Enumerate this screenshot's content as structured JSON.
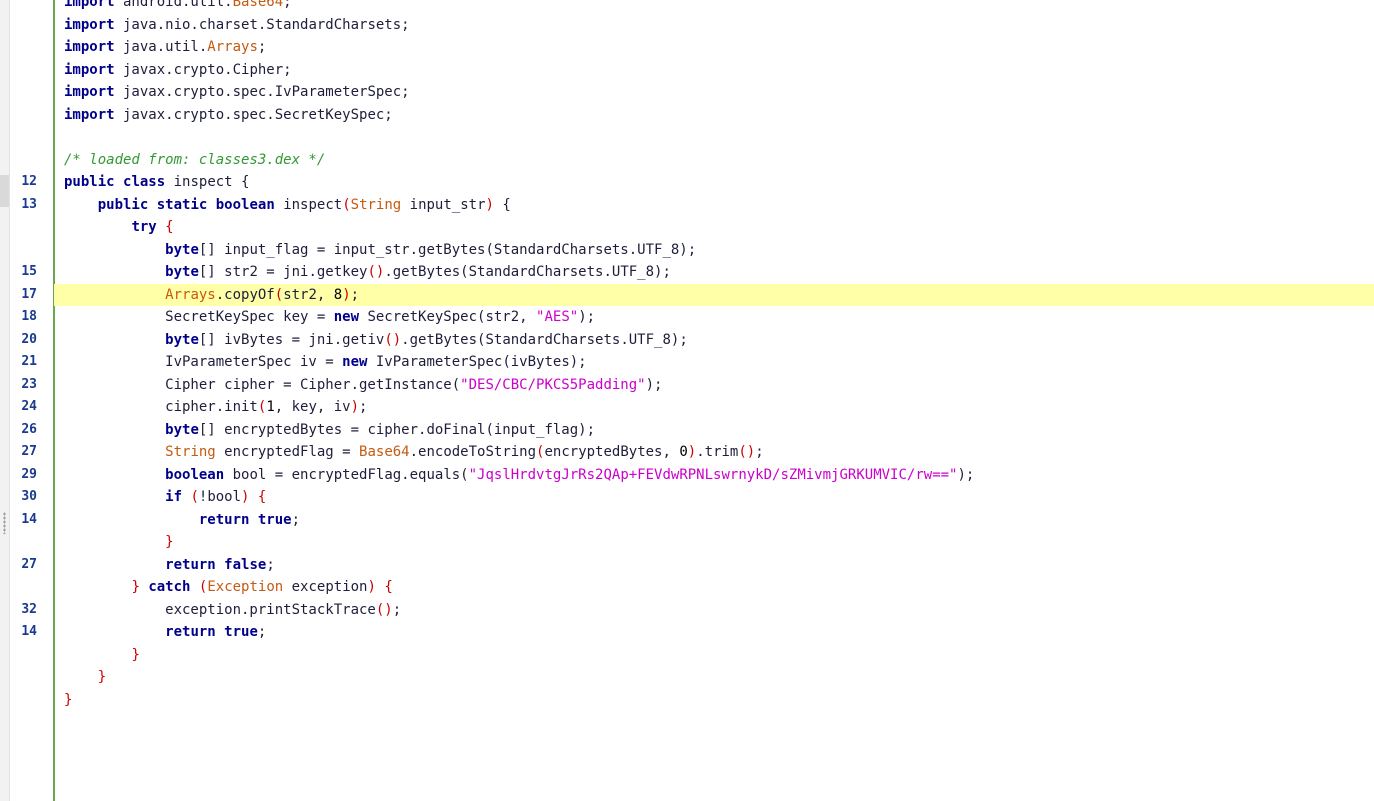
{
  "editor": {
    "lines": [
      {
        "ln": "",
        "tokens": [
          {
            "t": "import",
            "k": "kw"
          },
          {
            "t": " android.util.",
            "k": "plain"
          },
          {
            "t": "Base64",
            "k": "type"
          },
          {
            "t": ";",
            "k": "plain"
          }
        ]
      },
      {
        "ln": "",
        "tokens": [
          {
            "t": "import",
            "k": "kw"
          },
          {
            "t": " java.nio.charset.StandardCharsets;",
            "k": "plain"
          }
        ]
      },
      {
        "ln": "",
        "tokens": [
          {
            "t": "import",
            "k": "kw"
          },
          {
            "t": " java.util.",
            "k": "plain"
          },
          {
            "t": "Arrays",
            "k": "type"
          },
          {
            "t": ";",
            "k": "plain"
          }
        ]
      },
      {
        "ln": "",
        "tokens": [
          {
            "t": "import",
            "k": "kw"
          },
          {
            "t": " javax.crypto.Cipher;",
            "k": "plain"
          }
        ]
      },
      {
        "ln": "",
        "tokens": [
          {
            "t": "import",
            "k": "kw"
          },
          {
            "t": " javax.crypto.spec.IvParameterSpec;",
            "k": "plain"
          }
        ]
      },
      {
        "ln": "",
        "tokens": [
          {
            "t": "import",
            "k": "kw"
          },
          {
            "t": " javax.crypto.spec.SecretKeySpec;",
            "k": "plain"
          }
        ]
      },
      {
        "ln": "",
        "tokens": []
      },
      {
        "ln": "",
        "tokens": [
          {
            "t": "/* loaded from: classes3.dex */",
            "k": "cmt"
          }
        ]
      },
      {
        "ln": "12",
        "tokens": [
          {
            "t": "public",
            "k": "kw"
          },
          {
            "t": " ",
            "k": "plain"
          },
          {
            "t": "class",
            "k": "kw"
          },
          {
            "t": " inspect ",
            "k": "plain"
          },
          {
            "t": "{",
            "k": "plain"
          }
        ]
      },
      {
        "ln": "13",
        "tokens": [
          {
            "t": "    ",
            "k": "plain"
          },
          {
            "t": "public",
            "k": "kw"
          },
          {
            "t": " ",
            "k": "plain"
          },
          {
            "t": "static",
            "k": "kw"
          },
          {
            "t": " ",
            "k": "plain"
          },
          {
            "t": "boolean",
            "k": "kw"
          },
          {
            "t": " inspect",
            "k": "plain"
          },
          {
            "t": "(",
            "k": "punc"
          },
          {
            "t": "String",
            "k": "type"
          },
          {
            "t": " input_str",
            "k": "plain"
          },
          {
            "t": ")",
            "k": "punc"
          },
          {
            "t": " {",
            "k": "plain"
          }
        ]
      },
      {
        "ln": "",
        "tokens": [
          {
            "t": "        ",
            "k": "plain"
          },
          {
            "t": "try",
            "k": "kw"
          },
          {
            "t": " ",
            "k": "plain"
          },
          {
            "t": "{",
            "k": "punc"
          }
        ]
      },
      {
        "ln": "",
        "tokens": [
          {
            "t": "            ",
            "k": "plain"
          },
          {
            "t": "byte",
            "k": "kw"
          },
          {
            "t": "[] input_flag = input_str.getBytes(StandardCharsets.UTF_8);",
            "k": "plain"
          }
        ]
      },
      {
        "ln": "15",
        "tokens": [
          {
            "t": "            ",
            "k": "plain"
          },
          {
            "t": "byte",
            "k": "kw"
          },
          {
            "t": "[] str2 = jni.getkey",
            "k": "plain"
          },
          {
            "t": "()",
            "k": "punc"
          },
          {
            "t": ".getBytes(StandardCharsets.UTF_8);",
            "k": "plain"
          }
        ]
      },
      {
        "ln": "17",
        "hl": true,
        "tokens": [
          {
            "t": "            ",
            "k": "plain"
          },
          {
            "t": "Arrays",
            "k": "type"
          },
          {
            "t": ".copyOf",
            "k": "plain"
          },
          {
            "t": "(",
            "k": "punc"
          },
          {
            "t": "str2, ",
            "k": "plain"
          },
          {
            "t": "8",
            "k": "num"
          },
          {
            "t": ")",
            "k": "punc"
          },
          {
            "t": ";",
            "k": "plain"
          }
        ]
      },
      {
        "ln": "18",
        "tokens": [
          {
            "t": "            SecretKeySpec key = ",
            "k": "plain"
          },
          {
            "t": "new",
            "k": "kw"
          },
          {
            "t": " SecretKeySpec(str2, ",
            "k": "plain"
          },
          {
            "t": "\"AES\"",
            "k": "str"
          },
          {
            "t": ");",
            "k": "plain"
          }
        ]
      },
      {
        "ln": "20",
        "tokens": [
          {
            "t": "            ",
            "k": "plain"
          },
          {
            "t": "byte",
            "k": "kw"
          },
          {
            "t": "[] ivBytes = jni.getiv",
            "k": "plain"
          },
          {
            "t": "()",
            "k": "punc"
          },
          {
            "t": ".getBytes(StandardCharsets.UTF_8);",
            "k": "plain"
          }
        ]
      },
      {
        "ln": "21",
        "tokens": [
          {
            "t": "            IvParameterSpec iv = ",
            "k": "plain"
          },
          {
            "t": "new",
            "k": "kw"
          },
          {
            "t": " IvParameterSpec(ivBytes);",
            "k": "plain"
          }
        ]
      },
      {
        "ln": "23",
        "tokens": [
          {
            "t": "            Cipher cipher = Cipher.getInstance(",
            "k": "plain"
          },
          {
            "t": "\"DES/CBC/PKCS5Padding\"",
            "k": "str"
          },
          {
            "t": ");",
            "k": "plain"
          }
        ]
      },
      {
        "ln": "24",
        "tokens": [
          {
            "t": "            cipher.init",
            "k": "plain"
          },
          {
            "t": "(",
            "k": "punc"
          },
          {
            "t": "1",
            "k": "num"
          },
          {
            "t": ", key, iv",
            "k": "plain"
          },
          {
            "t": ")",
            "k": "punc"
          },
          {
            "t": ";",
            "k": "plain"
          }
        ]
      },
      {
        "ln": "26",
        "tokens": [
          {
            "t": "            ",
            "k": "plain"
          },
          {
            "t": "byte",
            "k": "kw"
          },
          {
            "t": "[] encryptedBytes = cipher.doFinal(input_flag);",
            "k": "plain"
          }
        ]
      },
      {
        "ln": "27",
        "tokens": [
          {
            "t": "            ",
            "k": "plain"
          },
          {
            "t": "String",
            "k": "type"
          },
          {
            "t": " encryptedFlag = ",
            "k": "plain"
          },
          {
            "t": "Base64",
            "k": "type"
          },
          {
            "t": ".encodeToString",
            "k": "plain"
          },
          {
            "t": "(",
            "k": "punc"
          },
          {
            "t": "encryptedBytes, ",
            "k": "plain"
          },
          {
            "t": "0",
            "k": "num"
          },
          {
            "t": ")",
            "k": "punc"
          },
          {
            "t": ".trim",
            "k": "plain"
          },
          {
            "t": "()",
            "k": "punc"
          },
          {
            "t": ";",
            "k": "plain"
          }
        ]
      },
      {
        "ln": "29",
        "tokens": [
          {
            "t": "            ",
            "k": "plain"
          },
          {
            "t": "boolean",
            "k": "kw"
          },
          {
            "t": " bool = encryptedFlag.equals(",
            "k": "plain"
          },
          {
            "t": "\"JqslHrdvtgJrRs2QAp+FEVdwRPNLswrnykD/sZMivmjGRKUMVIC/rw==\"",
            "k": "str"
          },
          {
            "t": ");",
            "k": "plain"
          }
        ]
      },
      {
        "ln": "30",
        "tokens": [
          {
            "t": "            ",
            "k": "plain"
          },
          {
            "t": "if",
            "k": "kw"
          },
          {
            "t": " ",
            "k": "plain"
          },
          {
            "t": "(",
            "k": "punc"
          },
          {
            "t": "!bool",
            "k": "plain"
          },
          {
            "t": ")",
            "k": "punc"
          },
          {
            "t": " ",
            "k": "plain"
          },
          {
            "t": "{",
            "k": "punc"
          }
        ]
      },
      {
        "ln": "14",
        "tokens": [
          {
            "t": "                ",
            "k": "plain"
          },
          {
            "t": "return",
            "k": "kw"
          },
          {
            "t": " ",
            "k": "plain"
          },
          {
            "t": "true",
            "k": "kw"
          },
          {
            "t": ";",
            "k": "plain"
          }
        ]
      },
      {
        "ln": "",
        "tokens": [
          {
            "t": "            ",
            "k": "plain"
          },
          {
            "t": "}",
            "k": "punc"
          }
        ]
      },
      {
        "ln": "27",
        "tokens": [
          {
            "t": "            ",
            "k": "plain"
          },
          {
            "t": "return",
            "k": "kw"
          },
          {
            "t": " ",
            "k": "plain"
          },
          {
            "t": "false",
            "k": "kw"
          },
          {
            "t": ";",
            "k": "plain"
          }
        ]
      },
      {
        "ln": "",
        "tokens": [
          {
            "t": "        ",
            "k": "plain"
          },
          {
            "t": "}",
            "k": "punc"
          },
          {
            "t": " ",
            "k": "plain"
          },
          {
            "t": "catch",
            "k": "kw"
          },
          {
            "t": " ",
            "k": "plain"
          },
          {
            "t": "(",
            "k": "punc"
          },
          {
            "t": "Exception",
            "k": "type"
          },
          {
            "t": " exception",
            "k": "plain"
          },
          {
            "t": ")",
            "k": "punc"
          },
          {
            "t": " ",
            "k": "plain"
          },
          {
            "t": "{",
            "k": "punc"
          }
        ]
      },
      {
        "ln": "32",
        "tokens": [
          {
            "t": "            exception.printStackTrace",
            "k": "plain"
          },
          {
            "t": "()",
            "k": "punc"
          },
          {
            "t": ";",
            "k": "plain"
          }
        ]
      },
      {
        "ln": "14",
        "tokens": [
          {
            "t": "            ",
            "k": "plain"
          },
          {
            "t": "return",
            "k": "kw"
          },
          {
            "t": " ",
            "k": "plain"
          },
          {
            "t": "true",
            "k": "kw"
          },
          {
            "t": ";",
            "k": "plain"
          }
        ]
      },
      {
        "ln": "",
        "tokens": [
          {
            "t": "        ",
            "k": "plain"
          },
          {
            "t": "}",
            "k": "punc"
          }
        ]
      },
      {
        "ln": "",
        "tokens": [
          {
            "t": "    ",
            "k": "plain"
          },
          {
            "t": "}",
            "k": "punc"
          }
        ]
      },
      {
        "ln": "",
        "tokens": [
          {
            "t": "}",
            "k": "punc"
          }
        ]
      }
    ]
  },
  "colors": {
    "keyword": "#00008b",
    "type": "#c55a11",
    "string": "#cc00cc",
    "comment": "#339933",
    "line_number": "#1a3a8f",
    "highlight": "#ffffa8",
    "gutter_border": "#6aa84f"
  }
}
